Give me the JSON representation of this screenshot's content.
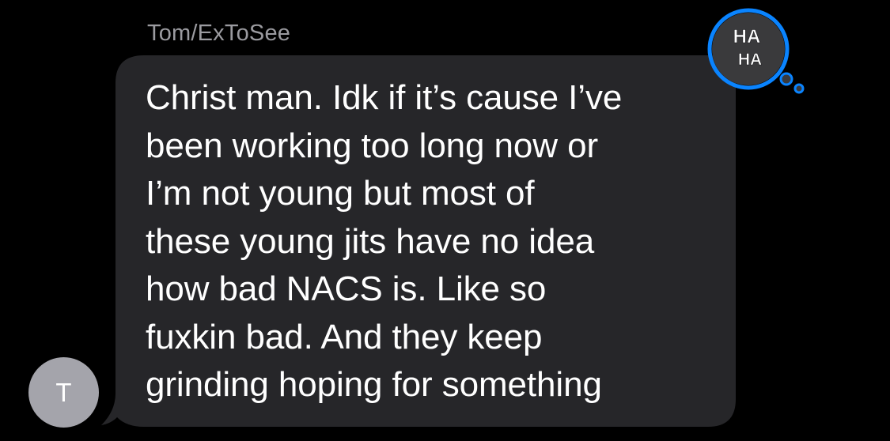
{
  "message": {
    "sender": "Tom/ExToSee",
    "avatar_initial": "T",
    "lines": [
      "Christ man. Idk if it’s cause I’ve",
      "been working too long now or",
      "I’m not young but most of",
      "these young jits have no idea",
      "how bad NACS is. Like so",
      "fuxkin bad. And they keep",
      "grinding hoping for something"
    ],
    "tapback": {
      "icon": "haha-icon",
      "text_top": "HA",
      "text_bottom": "HA"
    }
  },
  "colors": {
    "background": "#000000",
    "bubble": "#262629",
    "avatar": "#a4a4ab",
    "sender_text": "#9b9ba0",
    "tapback_bg": "#3a3a3c",
    "tapback_border": "#0a84ff"
  }
}
